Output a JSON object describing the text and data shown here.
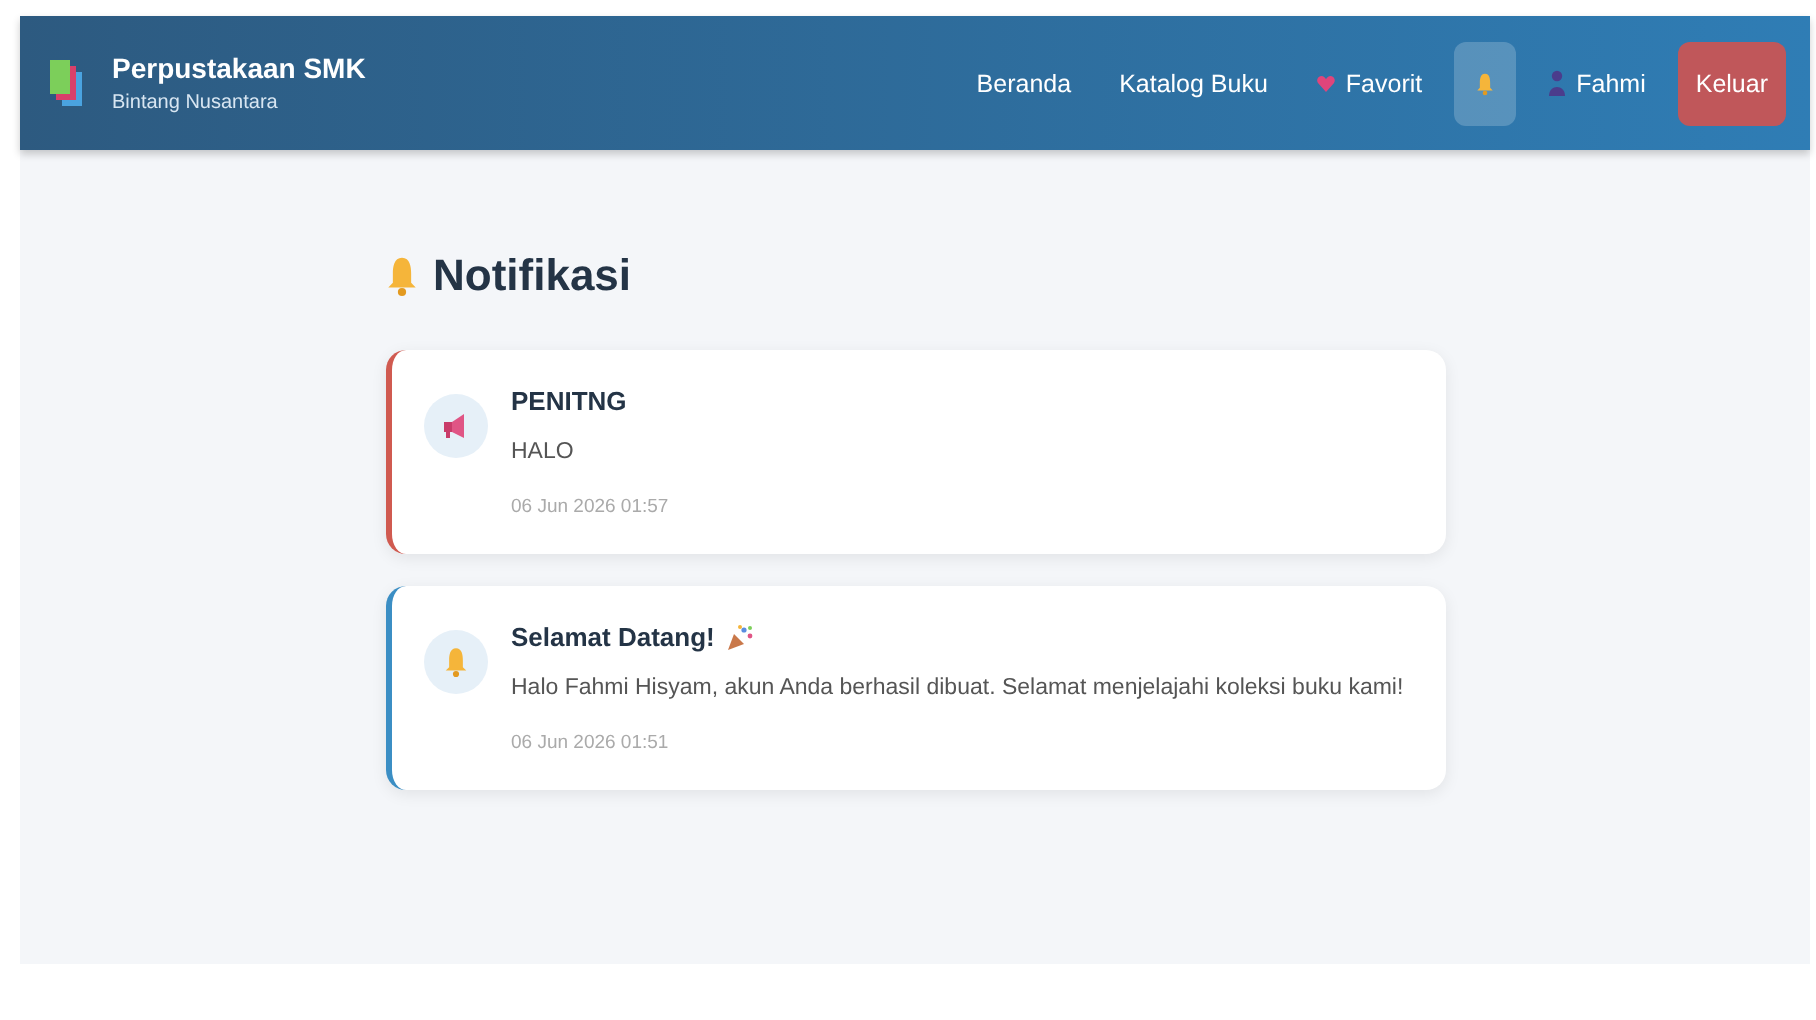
{
  "header": {
    "title": "Perpustakaan SMK",
    "subtitle": "Bintang Nusantara"
  },
  "nav": [
    {
      "kind": "text",
      "label": "Beranda",
      "selected": false
    },
    {
      "kind": "text",
      "label": "Katalog Buku",
      "selected": false
    },
    {
      "kind": "heart",
      "label": "Favorit",
      "selected": false
    },
    {
      "kind": "bell",
      "selected": true
    },
    {
      "kind": "user",
      "label": "Fahmi",
      "selected": false
    },
    {
      "kind": "logout",
      "label": "Keluar",
      "selected": false
    }
  ],
  "page_title": "Notifikasi",
  "notifications": [
    {
      "kind": "important",
      "color": "#d05a50",
      "title": "PENITNG",
      "message": "HALO",
      "time": "06 Jun 2026 01:57",
      "party": false
    },
    {
      "kind": "info",
      "color": "#3b8ec4",
      "title": "Selamat Datang!",
      "message": "Halo Fahmi Hisyam, akun Anda berhasil dibuat. Selamat menjelajahi koleksi buku kami!",
      "time": "06 Jun 2026 01:51",
      "party": true
    }
  ]
}
